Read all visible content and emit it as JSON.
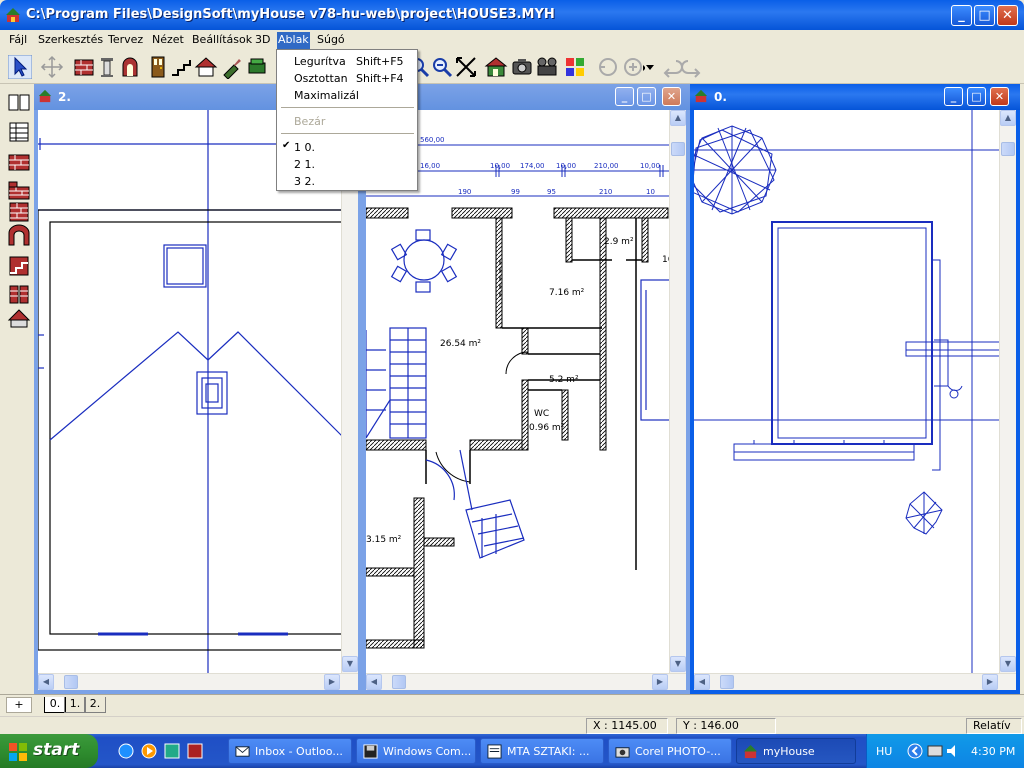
{
  "window": {
    "title": "C:\\Program Files\\DesignSoft\\myHouse v78-hu-web\\project\\HOUSE3.MYH",
    "min": "_",
    "max": "□",
    "close": "✕"
  },
  "menu": [
    "Fájl",
    "Szerkesztés",
    "Tervez",
    "Nézet",
    "Beállítások",
    "3D",
    "Ablak",
    "Súgó"
  ],
  "menu_active": "Ablak",
  "dropdown": {
    "items": [
      {
        "label": "Legurítva",
        "shortcut": "Shift+F5"
      },
      {
        "label": "Osztottan",
        "shortcut": "Shift+F4"
      },
      {
        "label": "Maximalizál",
        "shortcut": ""
      },
      {
        "label": "Bezár",
        "shortcut": "",
        "disabled": true
      },
      {
        "label": "1 0.",
        "checked": true
      },
      {
        "label": "2 1."
      },
      {
        "label": "3 2."
      }
    ]
  },
  "toolbar_icons": [
    "select-arrow-icon",
    "move-icon",
    "wall-icon",
    "column-icon",
    "arch-door-icon",
    "door-icon",
    "stairs-icon",
    "roof-icon",
    "brush-icon",
    "furniture-icon",
    "zoom-icon",
    "zoom-out-icon",
    "fit-icon",
    "house-3d-icon",
    "camera-icon",
    "film-icon",
    "palette-icon",
    "undo-icon",
    "redo-icon",
    "back-icon",
    "forward-icon"
  ],
  "left_tools": [
    "book-icon",
    "table-icon",
    "brick-wall-icon",
    "brick-corner-icon",
    "brick-stack-icon",
    "brick-arch-icon",
    "stair-wall-icon",
    "brick-pillar-icon",
    "roof-wall-icon"
  ],
  "windows": {
    "w2": {
      "title": "2."
    },
    "w1": {
      "title": "",
      "dims": {
        "top": "560,00",
        "row1": [
          "16,00",
          "10,00",
          "174,00",
          "10,00",
          "210,00",
          "10,00"
        ],
        "row2": [
          "190",
          "99",
          "95",
          "210",
          "10"
        ]
      },
      "rooms": [
        "2.9 m²",
        "7.16 m²",
        "26.54 m²",
        "5.2 m²",
        "WC",
        "0.96 m²",
        "3.15 m²",
        "16"
      ]
    },
    "w0": {
      "title": "0."
    }
  },
  "tabs": [
    "+",
    "0.",
    "1.",
    "2."
  ],
  "status": {
    "x_label": "X :",
    "x_value": "1145.00",
    "y_label": "Y :",
    "y_value": "146.00",
    "mode": "Relatív"
  },
  "taskbar": {
    "start": "start",
    "items": [
      "Inbox - Outloo...",
      "Windows Com...",
      "MTA SZTAKI: ...",
      "Corel PHOTO-...",
      "myHouse"
    ],
    "lang": "HU",
    "time": "4:30 PM"
  },
  "colors": {
    "accent": "#0a5fe8",
    "plan_line": "#1a2dbf",
    "wall": "#000000"
  }
}
